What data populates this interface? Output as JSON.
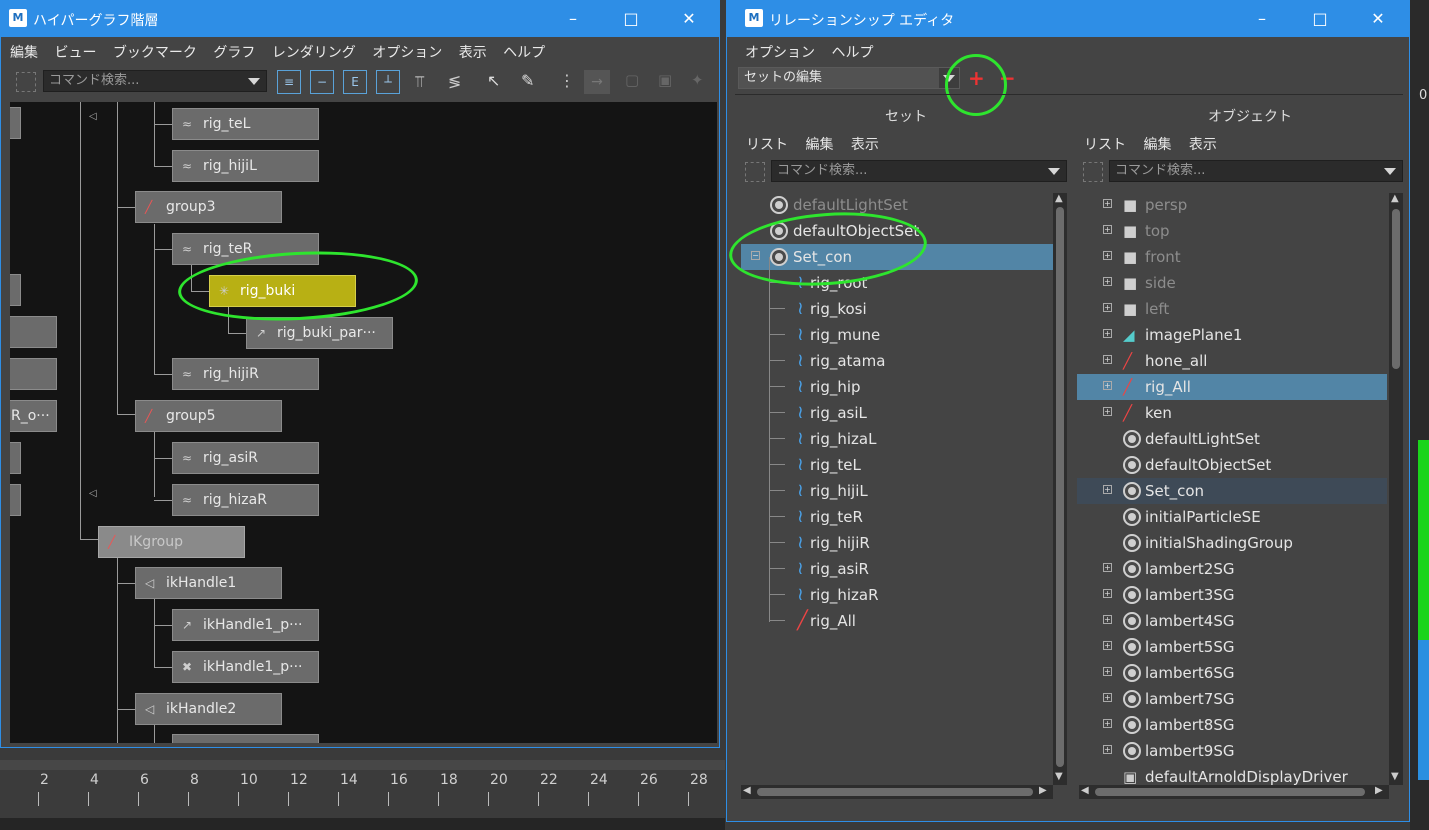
{
  "hypergraph": {
    "title": "ハイパーグラフ階層",
    "menu": [
      "編集",
      "ビュー",
      "ブックマーク",
      "グラフ",
      "レンダリング",
      "オプション",
      "表示",
      "ヘルプ"
    ],
    "search_placeholder": "コマンド検索...",
    "nodes": {
      "rig_teL": "rig_teL",
      "rig_hijiL": "rig_hijiL",
      "group3": "group3",
      "rig_teR": "rig_teR",
      "rig_buki": "rig_buki",
      "rig_buki_par": "rig_buki_par···",
      "rig_hijiR": "rig_hijiR",
      "r_o": "R_o···",
      "group5": "group5",
      "rig_asiR": "rig_asiR",
      "rig_hizaR": "rig_hizaR",
      "IKgroup": "IKgroup",
      "ikHandle1": "ikHandle1",
      "ikHandle1_p1": "ikHandle1_p···",
      "ikHandle1_p2": "ikHandle1_p···",
      "ikHandle2": "ikHandle2"
    }
  },
  "timeline": {
    "ticks": [
      "2",
      "4",
      "6",
      "8",
      "10",
      "12",
      "14",
      "16",
      "18",
      "20",
      "22",
      "24",
      "26",
      "28"
    ]
  },
  "relationship": {
    "title": "リレーションシップ エディタ",
    "menu": [
      "オプション",
      "ヘルプ"
    ],
    "mode": "セットの編集",
    "sets_header": "セット",
    "objects_header": "オブジェクト",
    "sets_menu": [
      "リスト",
      "編集",
      "表示"
    ],
    "objects_menu": [
      "リスト",
      "編集",
      "表示"
    ],
    "search_placeholder": "コマンド検索...",
    "sets": [
      "defaultLightSet",
      "defaultObjectSet",
      "Set_con"
    ],
    "set_members": [
      "rig_root",
      "rig_kosi",
      "rig_mune",
      "rig_atama",
      "rig_hip",
      "rig_asiL",
      "rig_hizaL",
      "rig_teL",
      "rig_hijiL",
      "rig_teR",
      "rig_hijiR",
      "rig_asiR",
      "rig_hizaR",
      "rig_All"
    ],
    "objects": [
      "persp",
      "top",
      "front",
      "side",
      "left",
      "imagePlane1",
      "hone_all",
      "rig_All",
      "ken",
      "defaultLightSet",
      "defaultObjectSet",
      "Set_con",
      "initialParticleSE",
      "initialShadingGroup",
      "lambert2SG",
      "lambert3SG",
      "lambert4SG",
      "lambert5SG",
      "lambert6SG",
      "lambert7SG",
      "lambert8SG",
      "lambert9SG",
      "defaultArnoldDisplayDriver"
    ]
  },
  "side_label": "0",
  "colors": {
    "titlebar": "#2e8ee6",
    "selection": "#5285a6",
    "highlight_node": "#b8b014",
    "annotation": "#2ee52e"
  }
}
